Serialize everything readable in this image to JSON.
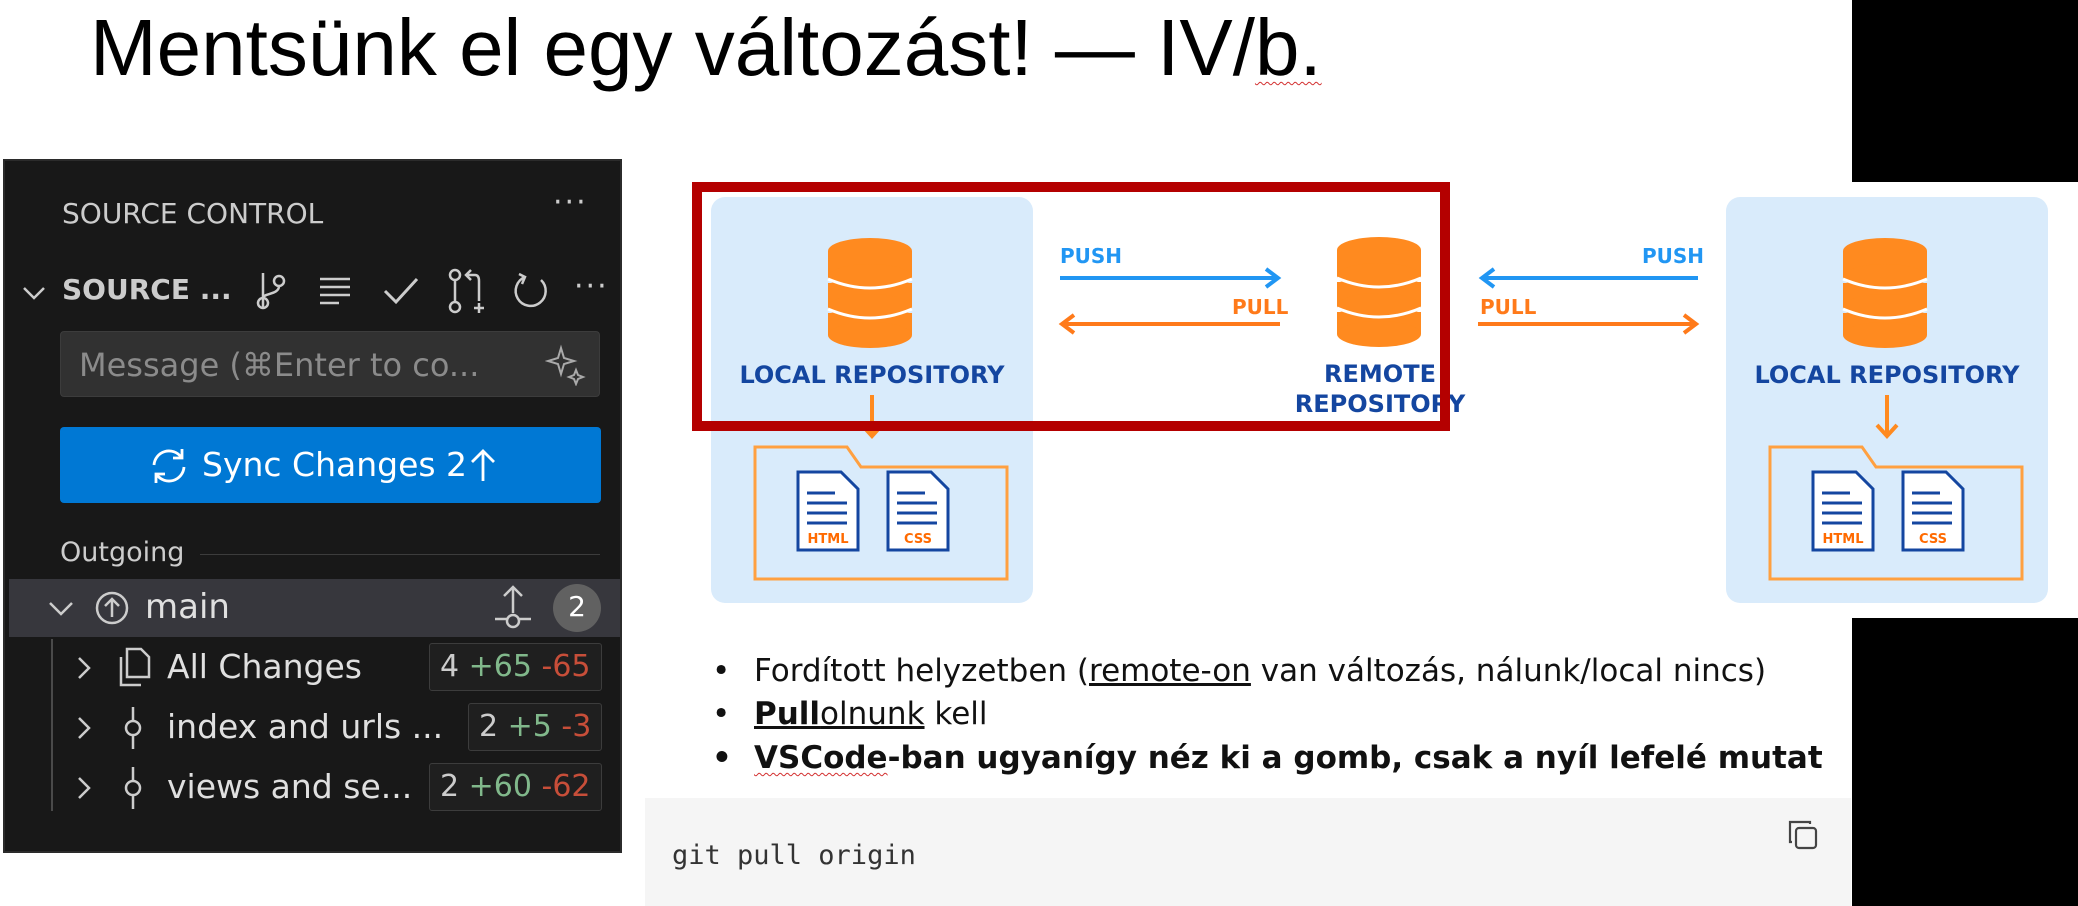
{
  "slide": {
    "title_main": "Mentsünk el egy változást! — IV/",
    "title_tail": "b."
  },
  "source_control": {
    "header": "SOURCE CONTROL",
    "repo_title": "SOURCE ...",
    "message_placeholder": "Message (⌘Enter to co...",
    "sync_label": "Sync Changes 2",
    "outgoing_label": "Outgoing",
    "branch": {
      "name": "main",
      "badge": "2"
    },
    "rows": [
      {
        "label": "All Changes",
        "count": "4",
        "added": "+65",
        "removed": "-65"
      },
      {
        "label": "index and urls ...",
        "count": "2",
        "added": "+5",
        "removed": "-3"
      },
      {
        "label": "views and se...",
        "count": "2",
        "added": "+60",
        "removed": "-62"
      }
    ]
  },
  "diagram": {
    "left_label": "LOCAL REPOSITORY",
    "remote_label_1": "REMOTE",
    "remote_label_2": "REPOSITORY",
    "right_label": "LOCAL REPOSITORY",
    "push_left": "PUSH",
    "pull_left": "PULL",
    "push_right": "PUSH",
    "pull_right": "PULL",
    "file_html": "HTML",
    "file_css": "CSS",
    "colors": {
      "blue": "#2196f3",
      "orange": "#ff7a1a",
      "navy": "#1446a0",
      "highlight": "#b40000"
    }
  },
  "bullets": {
    "b1_pre": "Fordított helyzetben (",
    "b1_link": "remote-on",
    "b1_post": " van változás, nálunk/local nincs)",
    "b2_bold": "Pull",
    "b2_squig": "olnunk",
    "b2_post": " kell",
    "b3_squig": "VSCode",
    "b3_rest": "-ban ugyanígy néz ki a gomb, csak a nyíl lefelé mutat"
  },
  "code": {
    "command": "git pull origin"
  }
}
